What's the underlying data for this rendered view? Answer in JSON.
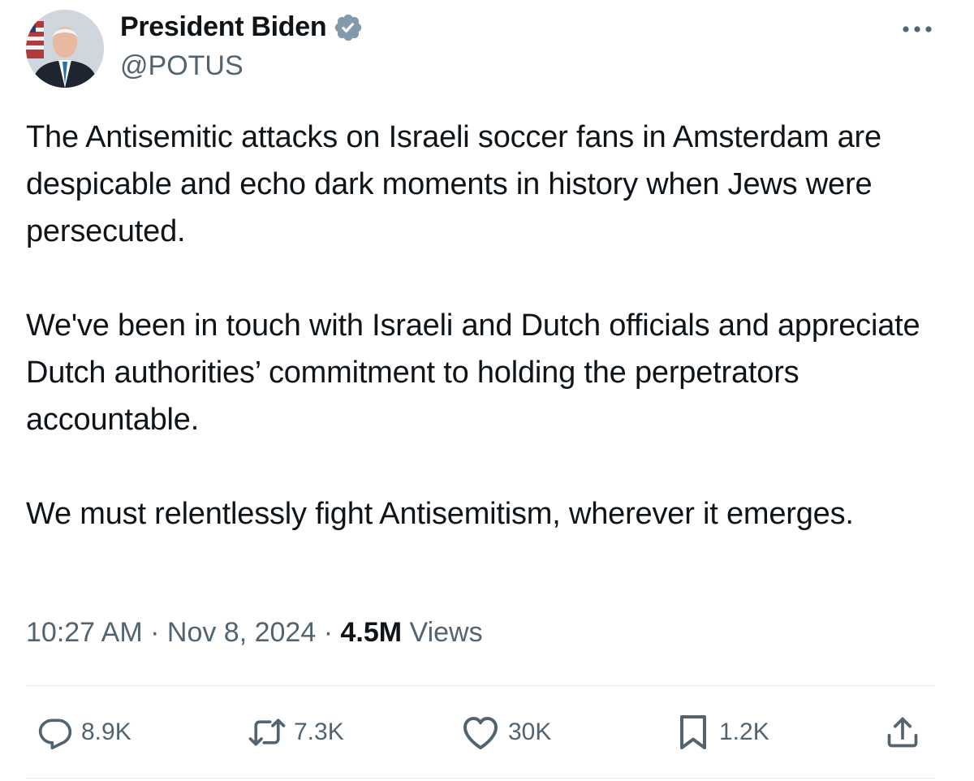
{
  "tweet": {
    "author": {
      "name": "President Biden",
      "handle": "@POTUS",
      "avatar_icon": "portrait-avatar",
      "verified_icon": "verified-badge-icon",
      "verified_color": "#829aab"
    },
    "more_icon": "more-options-icon",
    "paragraphs": [
      "The Antisemitic attacks on Israeli soccer fans in Amsterdam are despicable and echo dark moments in history when Jews were persecuted.",
      "We've been in touch with Israeli and Dutch officials and appreciate Dutch authorities’ commitment to holding the perpetrators accountable.",
      "We must relentlessly fight Antisemitism, wherever it emerges."
    ],
    "meta": {
      "time": "10:27 AM",
      "separator": "·",
      "date": "Nov 8, 2024",
      "views_count": "4.5M",
      "views_label": "Views"
    },
    "actions": {
      "replies": "8.9K",
      "reposts": "7.3K",
      "likes": "30K",
      "bookmarks": "1.2K"
    },
    "colors": {
      "text": "#0f1419",
      "secondary": "#536471",
      "divider": "#e4e9ed"
    }
  }
}
